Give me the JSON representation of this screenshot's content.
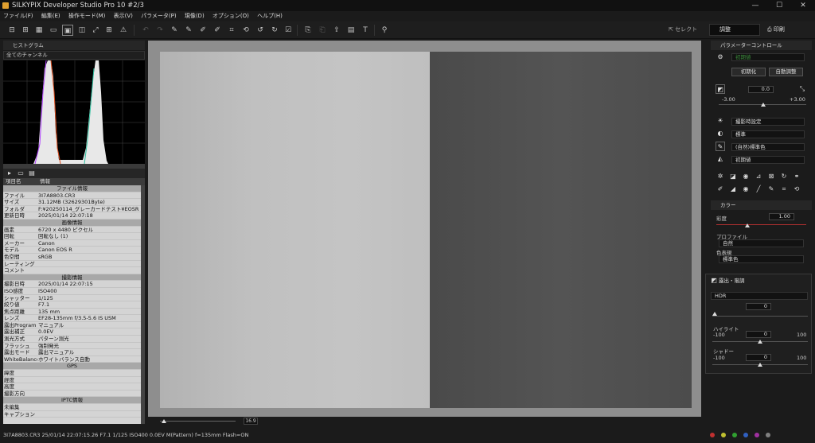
{
  "window": {
    "title": "SILKYPIX Developer Studio Pro 10   #2/3",
    "minimize": "—",
    "maximize": "☐",
    "close": "✕"
  },
  "menu": [
    "ファイル(F)",
    "編集(E)",
    "操作モード(M)",
    "表示(V)",
    "パラメータ(P)",
    "現像(D)",
    "オプション(O)",
    "ヘルプ(H)"
  ],
  "toolbar": {
    "select_label": "セレクト",
    "look_label": "調整",
    "print_label": "印刷"
  },
  "histogram": {
    "title": "ヒストグラム",
    "channel": "全てのチャンネル"
  },
  "info": {
    "col_key": "項目名",
    "col_val": "情報",
    "rows": [
      {
        "sec": "ファイル情報"
      },
      {
        "k": "ファイル",
        "v": "3I7A8803.CR3"
      },
      {
        "k": "サイズ",
        "v": "31.12MB (32629301Byte)"
      },
      {
        "k": "フォルダ",
        "v": "F:¥20250114_グレーカードテスト¥EOSR"
      },
      {
        "k": "更新日時",
        "v": "2025/01/14 22:07:18"
      },
      {
        "sec": "画像情報"
      },
      {
        "k": "画素",
        "v": "6720 x 4480 ピクセル"
      },
      {
        "k": "回転",
        "v": "回転なし (1)"
      },
      {
        "k": "メーカー",
        "v": "Canon"
      },
      {
        "k": "モデル",
        "v": "Canon EOS R"
      },
      {
        "k": "色空間",
        "v": "sRGB"
      },
      {
        "k": "レーティング",
        "v": ""
      },
      {
        "k": "コメント",
        "v": ""
      },
      {
        "sec": "撮影情報"
      },
      {
        "k": "撮影日時",
        "v": "2025/01/14 22:07:15"
      },
      {
        "k": "ISO感度",
        "v": "ISO400"
      },
      {
        "k": "シャッター",
        "v": "1/125"
      },
      {
        "k": "絞り値",
        "v": "F7.1"
      },
      {
        "k": "焦点距離",
        "v": "135 mm"
      },
      {
        "k": "レンズ",
        "v": "EF28-135mm f/3.5-5.6 IS USM"
      },
      {
        "k": "露出Program",
        "v": "マニュアル"
      },
      {
        "k": "露出補正",
        "v": "0.0EV"
      },
      {
        "k": "測光方式",
        "v": "パターン測光"
      },
      {
        "k": "フラッシュ",
        "v": "強制発光"
      },
      {
        "k": "露出モード",
        "v": "露出マニュアル"
      },
      {
        "k": "WhiteBalance",
        "v": "ホワイトバランス自動"
      },
      {
        "sec": "GPS"
      },
      {
        "k": "緯度",
        "v": ""
      },
      {
        "k": "経度",
        "v": ""
      },
      {
        "k": "高度",
        "v": ""
      },
      {
        "k": "撮影方向",
        "v": ""
      },
      {
        "sec": "IPTC情報"
      },
      {
        "k": "未編集",
        "v": ""
      },
      {
        "k": "キャプション",
        "v": ""
      }
    ]
  },
  "zoom": "16.9",
  "status_text": "3I7A8803.CR3 25/01/14 22:07:15.26 F7.1 1/125 ISO400  0.0EV M(Pattern) f=135mm Flash=ON",
  "param": {
    "title": "パラメーターコントロール",
    "preset": "初期値",
    "init_btn": "初期化",
    "auto_btn": "自動調整",
    "exposure_value": "0.0",
    "exposure_min": "-3.00",
    "exposure_max": "+3.00",
    "wb": "撮影時設定",
    "tone": "標準",
    "color": "(自然)標準色",
    "sharp": "初期値"
  },
  "color_panel": {
    "title": "カラー",
    "saturation_label": "彩度",
    "saturation_value": "1.00",
    "profile_label": "プロファイル",
    "profile_value": "自然",
    "look_label": "色表現",
    "look_value": "標準色"
  },
  "hdr_panel": {
    "title": "露出・階調",
    "mode": "HDR",
    "hdr_value": "0",
    "highlight_label": "ハイライト",
    "highlight_value": "0",
    "highlight_min": "-100",
    "highlight_max": "100",
    "shadow_label": "シャドー",
    "shadow_value": "0",
    "shadow_min": "-100",
    "shadow_max": "100"
  },
  "colors": {
    "accent_green": "#3a8a3a",
    "slider_red": "#b03030"
  }
}
